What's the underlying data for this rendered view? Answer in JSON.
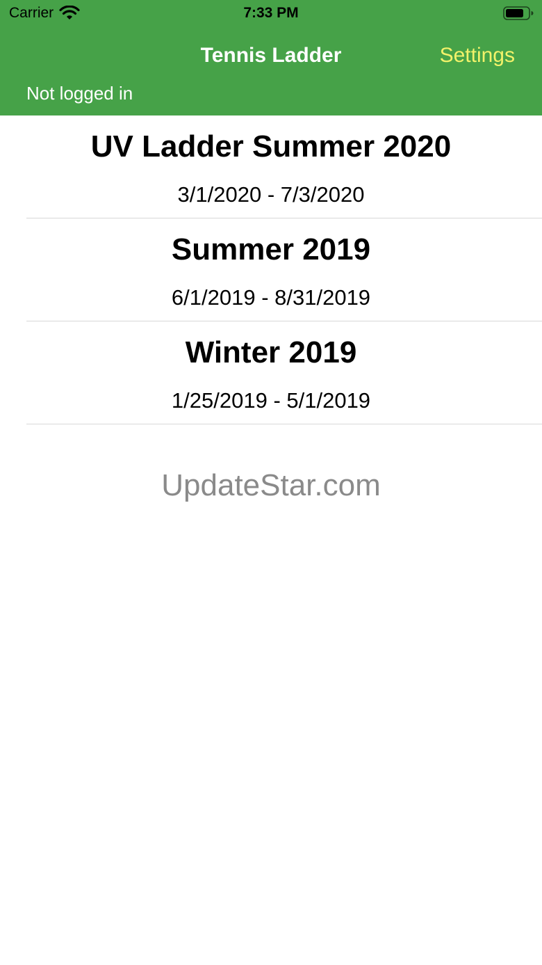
{
  "status_bar": {
    "carrier": "Carrier",
    "time": "7:33 PM",
    "wifi_icon": "wifi-icon",
    "battery_icon": "battery-icon"
  },
  "nav": {
    "title": "Tennis Ladder",
    "settings_label": "Settings",
    "login_status": "Not logged in"
  },
  "seasons": [
    {
      "name": "UV Ladder Summer 2020",
      "dates": "3/1/2020 - 7/3/2020"
    },
    {
      "name": "Summer 2019",
      "dates": "6/1/2019 - 8/31/2019"
    },
    {
      "name": "Winter 2019",
      "dates": "1/25/2019 - 5/1/2019"
    }
  ],
  "watermark": "UpdateStar.com",
  "colors": {
    "header_bg": "#46a248",
    "settings_text": "#f2f26a",
    "title_text": "#ffffff",
    "separator": "#d8d8d8",
    "watermark_text": "#8a8a8a"
  }
}
